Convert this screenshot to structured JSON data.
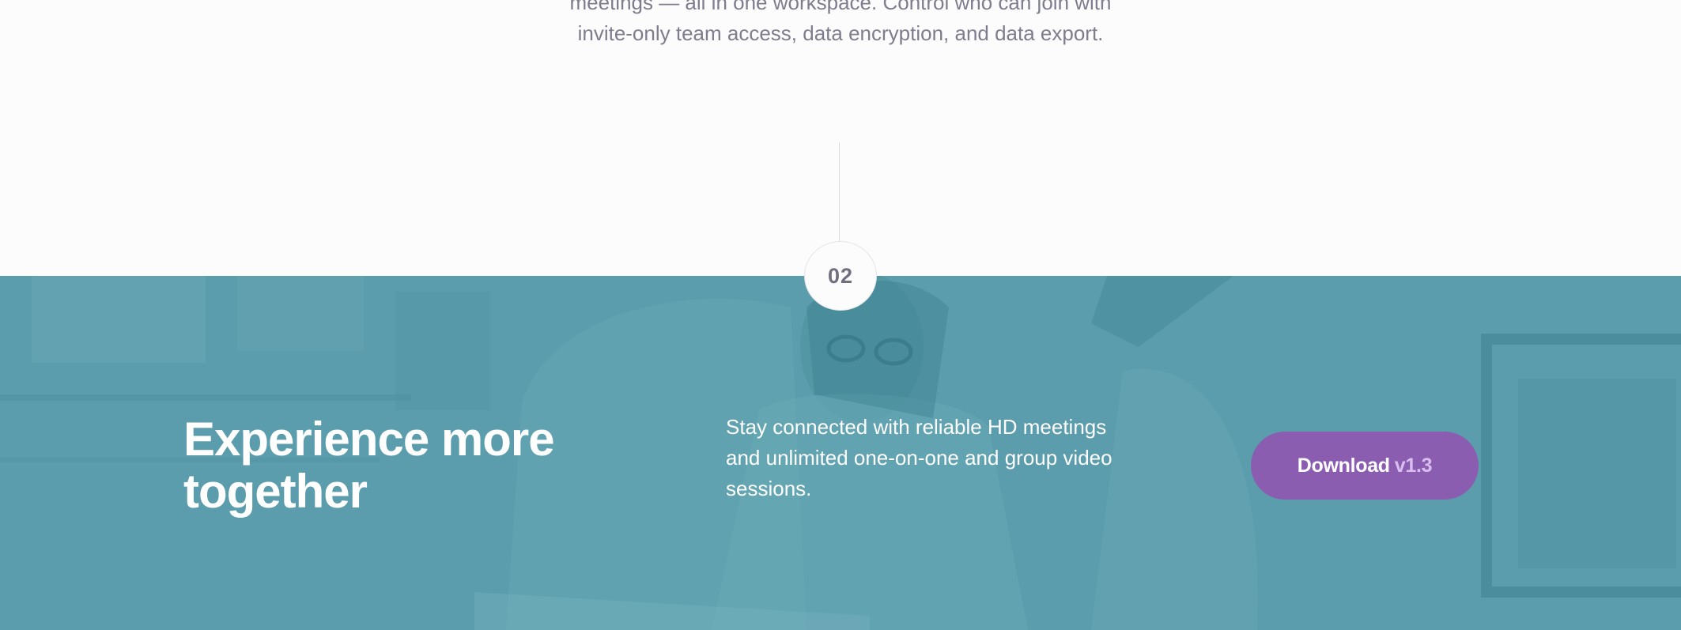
{
  "intro": {
    "text": "meetings — all in one workspace. Control who can join with invite-only team access, data encryption, and data export."
  },
  "step": {
    "number": "02"
  },
  "hero": {
    "title": "Experience more together",
    "description": "Stay connected with reliable HD meetings and unlimited one-on-one and group video sessions.",
    "download_label": "Download",
    "download_version": "v1.3"
  },
  "colors": {
    "hero_overlay": "#5b9dac",
    "button": "#8a5db1",
    "button_version": "#d8bff0",
    "intro_text": "#7d7d8e"
  }
}
